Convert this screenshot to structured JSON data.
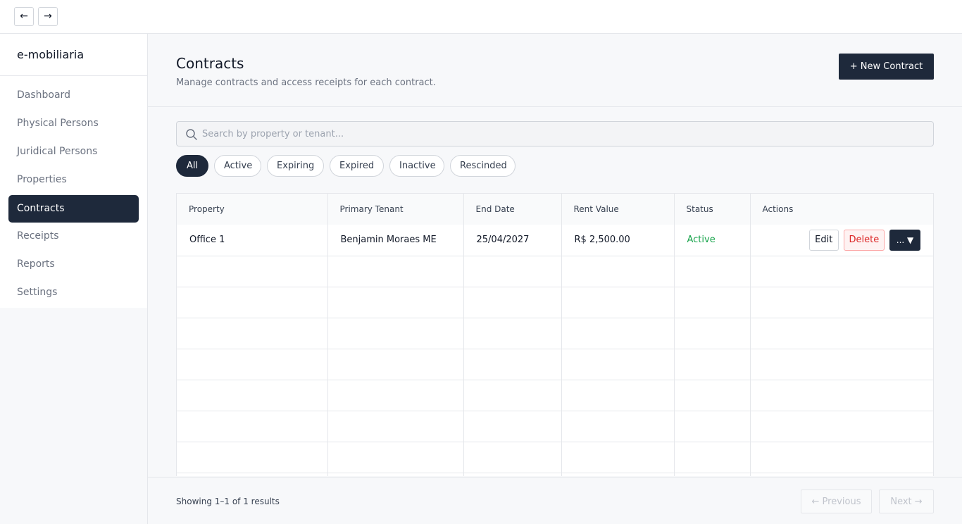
{
  "nav": {
    "back": "←",
    "forward": "→"
  },
  "sidebar": {
    "brand": "e-mobiliaria",
    "items": [
      {
        "label": "Dashboard",
        "active": false
      },
      {
        "label": "Physical Persons",
        "active": false
      },
      {
        "label": "Juridical Persons",
        "active": false
      },
      {
        "label": "Properties",
        "active": false
      },
      {
        "label": "Contracts",
        "active": true
      },
      {
        "label": "Receipts",
        "active": false
      },
      {
        "label": "Reports",
        "active": false
      },
      {
        "label": "Settings",
        "active": false
      }
    ]
  },
  "header": {
    "title": "Contracts",
    "subtitle": "Manage contracts and access receipts for each contract.",
    "new_button": "+ New Contract"
  },
  "search": {
    "placeholder": "Search by property or tenant...",
    "value": ""
  },
  "filters": [
    {
      "label": "All",
      "active": true
    },
    {
      "label": "Active",
      "active": false
    },
    {
      "label": "Expiring",
      "active": false
    },
    {
      "label": "Expired",
      "active": false
    },
    {
      "label": "Inactive",
      "active": false
    },
    {
      "label": "Rescinded",
      "active": false
    }
  ],
  "table": {
    "columns": [
      "Property",
      "Primary Tenant",
      "End Date",
      "Rent Value",
      "Status",
      "Actions"
    ],
    "rows": [
      {
        "property": "Office 1",
        "tenant": "Benjamin Moraes ME",
        "end_date": "25/04/2027",
        "rent": "R$ 2,500.00",
        "status": "Active"
      }
    ],
    "actions": {
      "edit": "Edit",
      "delete": "Delete",
      "more": "... ▼"
    }
  },
  "footer": {
    "results": "Showing 1–1 of 1 results",
    "previous": "← Previous",
    "next": "Next →"
  },
  "colors": {
    "accent": "#1e293b",
    "status_active": "#16a34a",
    "danger": "#dc2626"
  }
}
